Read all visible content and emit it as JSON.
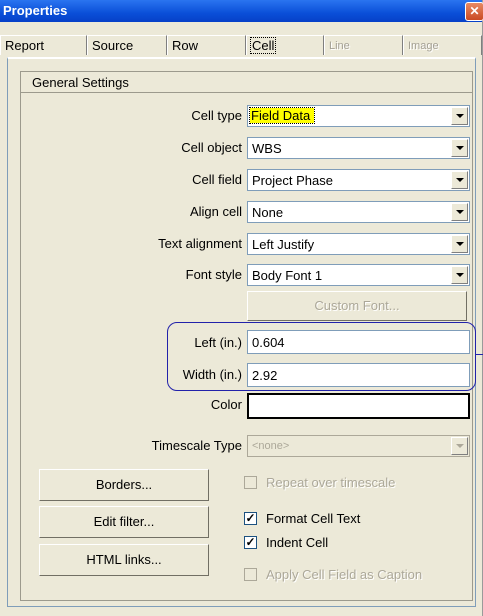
{
  "window": {
    "title": "Properties",
    "close_glyph": "✕"
  },
  "tabs": [
    {
      "label": "Report"
    },
    {
      "label": "Source"
    },
    {
      "label": "Row"
    },
    {
      "label": "Cell"
    },
    {
      "label": "Line"
    },
    {
      "label": "Image"
    }
  ],
  "group": {
    "title": "General Settings"
  },
  "fields": {
    "cell_type": {
      "label": "Cell type",
      "value": "Field Data"
    },
    "cell_object": {
      "label": "Cell object",
      "value": "WBS"
    },
    "cell_field": {
      "label": "Cell field",
      "value": "Project Phase"
    },
    "align_cell": {
      "label": "Align cell",
      "value": "None"
    },
    "text_alignment": {
      "label": "Text alignment",
      "value": "Left Justify"
    },
    "font_style": {
      "label": "Font style",
      "value": "Body Font 1"
    },
    "left": {
      "label": "Left (in.)",
      "value": "0.604"
    },
    "width": {
      "label": "Width (in.)",
      "value": "2.92"
    },
    "color": {
      "label": "Color"
    },
    "timescale_type": {
      "label": "Timescale Type",
      "value": "<none>"
    }
  },
  "buttons": {
    "custom_font": "Custom Font...",
    "borders": "Borders...",
    "edit_filter": "Edit filter...",
    "html_links": "HTML links..."
  },
  "checkboxes": {
    "repeat": {
      "label": "Repeat over timescale",
      "checked": false
    },
    "format_cell_text": {
      "label": "Format Cell Text",
      "checked": true,
      "mark": "✓"
    },
    "indent_cell": {
      "label": "Indent Cell",
      "checked": true,
      "mark": "✓"
    },
    "apply_caption": {
      "label": "Apply Cell Field as Caption",
      "checked": false
    }
  },
  "colors": {
    "title_bar": "#0a4fd8",
    "highlight": "#ffff00",
    "annotation": "#2222aa"
  }
}
